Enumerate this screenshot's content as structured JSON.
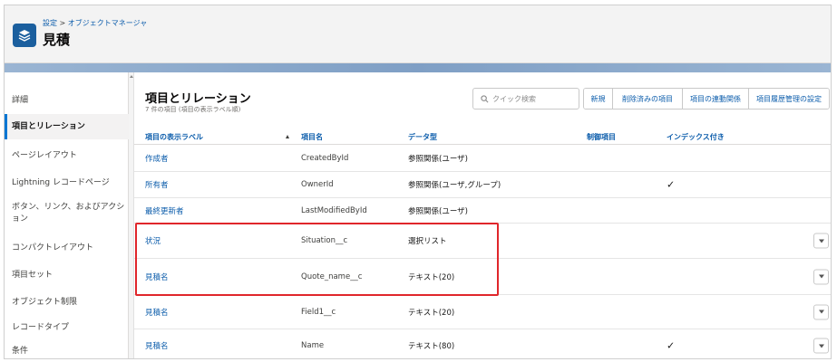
{
  "header": {
    "breadcrumb_setup": "設定",
    "breadcrumb_sep": " > ",
    "breadcrumb_object_manager": "オブジェクトマネージャ",
    "title": "見積",
    "icon": "layers-icon"
  },
  "sidebar": {
    "items": [
      {
        "label": "詳細"
      },
      {
        "label": "項目とリレーション"
      },
      {
        "label": "ページレイアウト"
      },
      {
        "label": "Lightning レコードページ"
      },
      {
        "label": "ボタン、リンク、およびアクション"
      },
      {
        "label": "コンパクトレイアウト"
      },
      {
        "label": "項目セット"
      },
      {
        "label": "オブジェクト制限"
      },
      {
        "label": "レコードタイプ"
      },
      {
        "label": "条件"
      }
    ],
    "active_index": 1
  },
  "section": {
    "title": "項目とリレーション",
    "subtitle": "7 件の項目 (項目の表示ラベル順)"
  },
  "search": {
    "placeholder": "クイック検索"
  },
  "toolbar": {
    "new_label": "新規",
    "deleted_label": "削除済みの項目",
    "dependency_label": "項目の連動関係",
    "history_label": "項目履歴管理の設定"
  },
  "table": {
    "headers": {
      "label": "項目の表示ラベル",
      "api": "項目名",
      "type": "データ型",
      "controlling": "制御項目",
      "indexed": "インデックス付き"
    },
    "rows": [
      {
        "label": "作成者",
        "api": "CreatedById",
        "type": "参照関係(ユーザ)",
        "indexed": "",
        "menu": false
      },
      {
        "label": "所有者",
        "api": "OwnerId",
        "type": "参照関係(ユーザ,グループ)",
        "indexed": "✓",
        "menu": false
      },
      {
        "label": "最終更新者",
        "api": "LastModifiedById",
        "type": "参照関係(ユーザ)",
        "indexed": "",
        "menu": false
      },
      {
        "label": "状況",
        "api": "Situation__c",
        "type": "選択リスト",
        "indexed": "",
        "menu": true
      },
      {
        "label": "見積名",
        "api": "Quote_name__c",
        "type": "テキスト(20)",
        "indexed": "",
        "menu": true
      },
      {
        "label": "見積名",
        "api": "Field1__c",
        "type": "テキスト(20)",
        "indexed": "",
        "menu": true
      },
      {
        "label": "見積名",
        "api": "Name",
        "type": "テキスト(80)",
        "indexed": "✓",
        "menu": true
      }
    ]
  },
  "colors": {
    "accent": "#0176d3",
    "link": "#0b5cab",
    "highlight": "#e0262b",
    "band": "#7f9fc5"
  }
}
